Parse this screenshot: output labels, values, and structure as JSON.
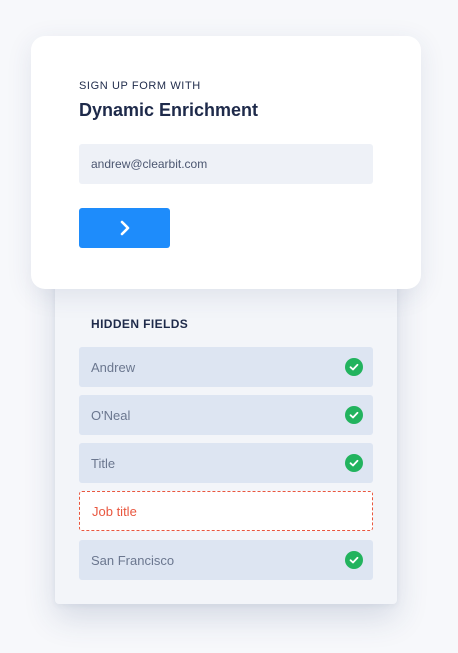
{
  "form": {
    "eyebrow": "SIGN UP FORM WITH",
    "title": "Dynamic Enrichment",
    "email_value": "andrew@clearbit.com",
    "submit_icon": "chevron-right-icon"
  },
  "hidden_fields": {
    "title": "HIDDEN FIELDS",
    "items": [
      {
        "label": "Andrew",
        "status": "filled",
        "icon": "check-circle-icon"
      },
      {
        "label": "O'Neal",
        "status": "filled",
        "icon": "check-circle-icon"
      },
      {
        "label": "Title",
        "status": "filled",
        "icon": "check-circle-icon"
      },
      {
        "label": "Job title",
        "status": "missing"
      },
      {
        "label": "San Francisco",
        "status": "filled",
        "icon": "check-circle-icon"
      }
    ]
  },
  "colors": {
    "accent": "#1e8cfb",
    "success": "#22b35e",
    "error": "#e9573f",
    "text_dark": "#1e2a4a"
  }
}
